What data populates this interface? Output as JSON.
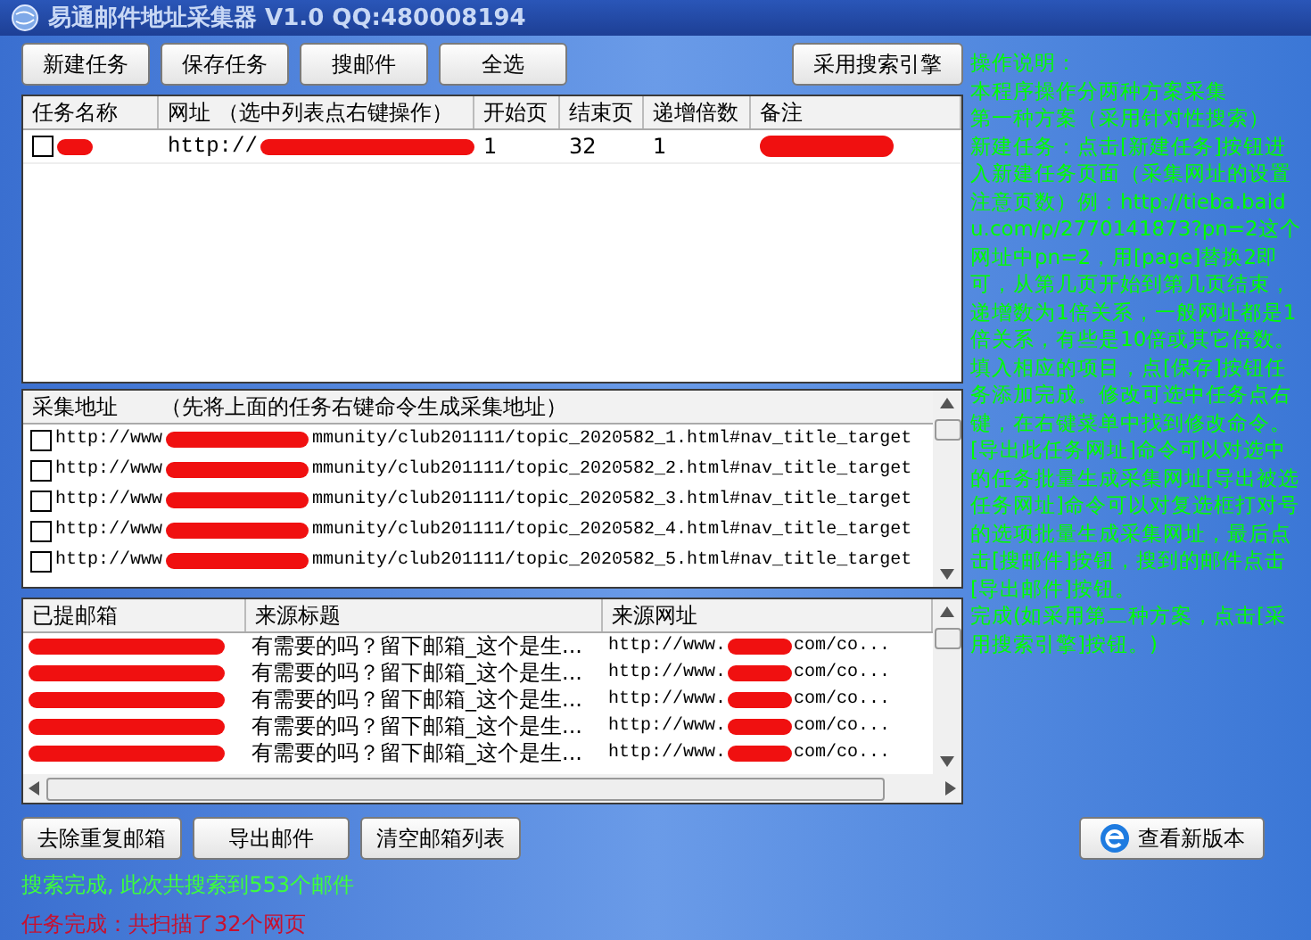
{
  "window": {
    "title": "易通邮件地址采集器 V1.0  QQ:480008194"
  },
  "toolbar": [
    {
      "label": "新建任务"
    },
    {
      "label": "保存任务"
    },
    {
      "label": "搜邮件"
    },
    {
      "label": "全选"
    }
  ],
  "search_engine_button": "采用搜索引擎",
  "task_table": {
    "columns": [
      "任务名称",
      "网址 （选中列表点右键操作）",
      "开始页",
      "结束页",
      "递增倍数",
      "备注"
    ],
    "rows": [
      {
        "checked": false,
        "name_redacted": true,
        "url": "http://",
        "url_redacted": true,
        "start": "1",
        "end": "32",
        "step": "1",
        "note_redacted": true
      }
    ]
  },
  "collect_table": {
    "title": "采集地址",
    "hint": "（先将上面的任务右键命令生成采集地址）",
    "rows": [
      {
        "checked": false,
        "prefix": "http://www",
        "suffix": "mmunity/club201111/topic_2020582_1.html#nav_title_target"
      },
      {
        "checked": false,
        "prefix": "http://www",
        "suffix": "mmunity/club201111/topic_2020582_2.html#nav_title_target"
      },
      {
        "checked": false,
        "prefix": "http://www",
        "suffix": "mmunity/club201111/topic_2020582_3.html#nav_title_target"
      },
      {
        "checked": false,
        "prefix": "http://www",
        "suffix": "mmunity/club201111/topic_2020582_4.html#nav_title_target"
      },
      {
        "checked": false,
        "prefix": "http://www",
        "suffix": "mmunity/club201111/topic_2020582_5.html#nav_title_target"
      }
    ]
  },
  "email_table": {
    "columns": [
      "已提邮箱",
      "来源标题",
      "来源网址"
    ],
    "rows": [
      {
        "title": "有需要的吗？留下邮箱_这个是生...",
        "url_prefix": "http://www.",
        "url_suffix": "com/co..."
      },
      {
        "title": "有需要的吗？留下邮箱_这个是生...",
        "url_prefix": "http://www.",
        "url_suffix": "com/co..."
      },
      {
        "title": "有需要的吗？留下邮箱_这个是生...",
        "url_prefix": "http://www.",
        "url_suffix": "com/co..."
      },
      {
        "title": "有需要的吗？留下邮箱_这个是生...",
        "url_prefix": "http://www.",
        "url_suffix": "com/co..."
      },
      {
        "title": "有需要的吗？留下邮箱_这个是生...",
        "url_prefix": "http://www.",
        "url_suffix": "com/co..."
      }
    ]
  },
  "bottom_buttons": [
    {
      "label": "去除重复邮箱"
    },
    {
      "label": "导出邮件"
    },
    {
      "label": "清空邮箱列表"
    }
  ],
  "new_version_button": "查看新版本",
  "status": [
    {
      "kind": "success",
      "text": "搜索完成, 此次共搜索到553个邮件"
    },
    {
      "kind": "error",
      "text": "任务完成：共扫描了32个网页"
    }
  ],
  "help": [
    "操作说明：",
    "本程序操作分两种方案采集",
    "第一种方案（采用针对性搜索）",
    "新建任务：点击[新建任务]按钮进入新建任务页面（采集网址的设置注意页数）例：http://tieba.baidu.com/p/2770141873?pn=2这个网址中pn=2，用[page]替换2即可，从第几页开始到第几页结束，递增数为1倍关系，一般网址都是1倍关系，有些是10倍或其它倍数。填入相应的项目，点[保存]按钮任务添加完成。修改可选中任务点右键，在右键菜单中找到修改命令。[导出此任务网址]命令可以对选中的任务批量生成采集网址[导出被选任务网址]命令可以对复选框打对号的选项批量生成采集网址，最后点击[搜邮件]按钮，搜到的邮件点击[导出邮件]按钮。",
    "完成(如采用第二种方案，点击[采用搜索引擎]按钮。)"
  ]
}
